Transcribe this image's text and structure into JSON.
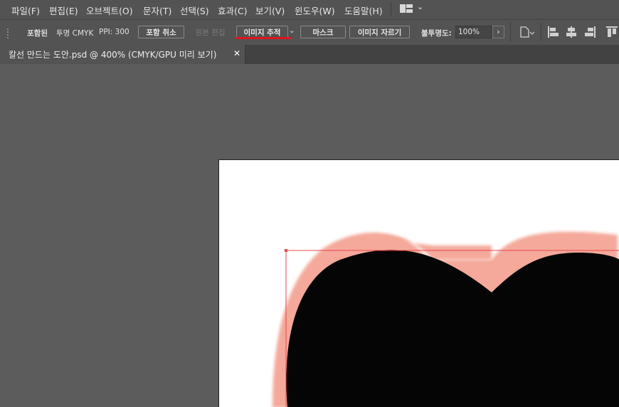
{
  "menu": {
    "items": [
      "파일(F)",
      "편집(E)",
      "오브젝트(O)",
      "문자(T)",
      "선택(S)",
      "효과(C)",
      "보기(V)",
      "윈도우(W)",
      "도움말(H)"
    ]
  },
  "controlbar": {
    "embedded_label": "포함된",
    "color_info": "투명 CMYK",
    "ppi": "PPI: 300",
    "unembed": "포함 취소",
    "edit_original": "원본 편집",
    "image_trace": "이미지 추적",
    "mask": "마스크",
    "crop_image": "이미지 자르기",
    "opacity_label": "불투명도:",
    "opacity_value": "100%"
  },
  "document": {
    "tab_title": "칼선 만드는 도안.psd @ 400% (CMYK/GPU 미리 보기)"
  },
  "colors": {
    "accent_underline": "#e0141e",
    "heart_outline": "#f4a99a",
    "heart_fill": "#050505",
    "bounding_box": "#e8474f"
  }
}
